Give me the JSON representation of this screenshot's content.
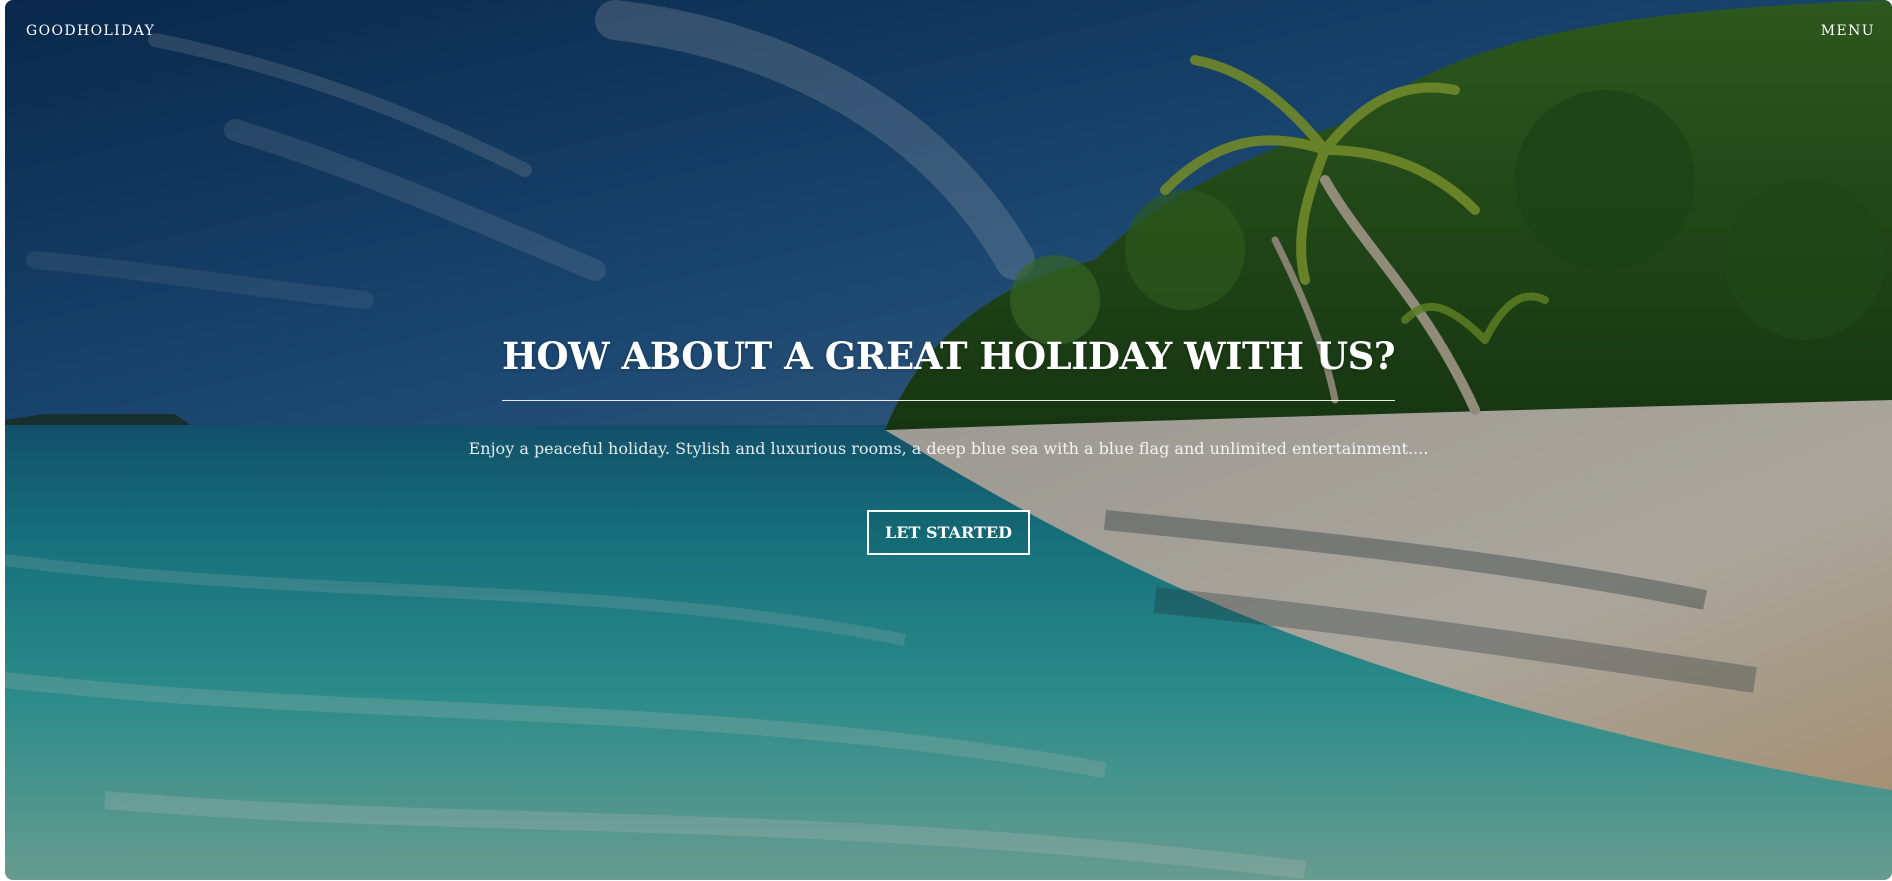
{
  "header": {
    "brand": "GOODHOLIDAY",
    "menu_label": "MENU"
  },
  "hero": {
    "title": "HOW ABOUT A GREAT HOLIDAY WITH US?",
    "subtitle": "Enjoy a peaceful holiday. Stylish and luxurious rooms, a deep blue sea with a blue flag and unlimited entertainment....",
    "cta_label": "LET STARTED",
    "background": "tropical-beach-photo"
  },
  "colors": {
    "text": "#ffffff",
    "sky": "#1e4f86",
    "sea": "#2fb3b8",
    "sand": "#e9e3d7",
    "foliage": "#2e5a22"
  }
}
